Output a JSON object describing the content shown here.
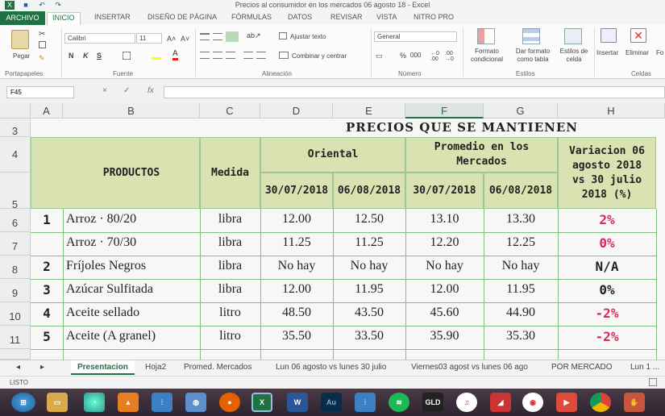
{
  "window": {
    "title": "Precios al consumidor en los mercados 06 agosto 18 - Excel"
  },
  "ribbon": {
    "tabs": [
      "ARCHIVO",
      "INICIO",
      "INSERTAR",
      "DISEÑO DE PÁGINA",
      "FÓRMULAS",
      "DATOS",
      "REVISAR",
      "VISTA",
      "NITRO PRO"
    ],
    "active_tab": "INICIO",
    "paste_label": "Pegar",
    "font_name": "Calibri",
    "font_size": "11",
    "bold": "N",
    "italic": "K",
    "underline": "S",
    "wrap_text": "Ajustar texto",
    "merge_center": "Combinar y centrar",
    "number_format": "General",
    "percent": "%",
    "thousands": "000",
    "conditional_format": "Formato condicional",
    "format_table": "Dar formato como tabla",
    "cell_styles": "Estilos de celda",
    "insert": "Insertar",
    "delete": "Eliminar",
    "format": "Fo",
    "groups": {
      "clipboard": "Portapapeles",
      "font": "Fuente",
      "alignment": "Alineación",
      "number": "Número",
      "styles": "Estilos",
      "cells": "Celdas"
    }
  },
  "formula_bar": {
    "name_box": "F45",
    "fx": "fx",
    "cancel": "×",
    "enter": "✓",
    "value": ""
  },
  "columns": [
    "A",
    "B",
    "C",
    "D",
    "E",
    "F",
    "G",
    "H"
  ],
  "selected_column": "F",
  "rows": [
    "3",
    "4",
    "5",
    "6",
    "7",
    "8",
    "9",
    "10",
    "11"
  ],
  "table": {
    "title": "PRECIOS QUE SE MANTIENEN",
    "header_productos": "PRODUCTOS",
    "header_medida": "Medida",
    "header_oriental": "Oriental",
    "header_promedio": "Promedio en los Mercados",
    "header_variacion": "Variacion 06 agosto 2018 vs 30 julio 2018 (%)",
    "date1": "30/07/2018",
    "date2": "06/08/2018",
    "date3": "30/07/2018",
    "date4": "06/08/2018",
    "items": [
      {
        "num": "1",
        "product": "Arroz · 80/20",
        "unit": "libra",
        "o1": "12.00",
        "o2": "12.50",
        "p1": "13.10",
        "p2": "13.30",
        "var": "2%",
        "var_color": "red"
      },
      {
        "num": "",
        "product": "Arroz · 70/30",
        "unit": "libra",
        "o1": "11.25",
        "o2": "11.25",
        "p1": "12.20",
        "p2": "12.25",
        "var": "0%",
        "var_color": "red"
      },
      {
        "num": "2",
        "product": "Fríjoles Negros",
        "unit": "libra",
        "o1": "No hay",
        "o2": "No hay",
        "p1": "No hay",
        "p2": "No hay",
        "var": "N/A",
        "var_color": "black"
      },
      {
        "num": "3",
        "product": "Azúcar Sulfitada",
        "unit": "libra",
        "o1": "12.00",
        "o2": "11.95",
        "p1": "12.00",
        "p2": "11.95",
        "var": "0%",
        "var_color": "black"
      },
      {
        "num": "4",
        "product": "Aceite sellado",
        "unit": "litro",
        "o1": "48.50",
        "o2": "43.50",
        "p1": "45.60",
        "p2": "44.90",
        "var": "-2%",
        "var_color": "red"
      },
      {
        "num": "5",
        "product": "Aceite (A granel)",
        "unit": "litro",
        "o1": "35.50",
        "o2": "33.50",
        "p1": "35.90",
        "p2": "35.30",
        "var": "-2%",
        "var_color": "red"
      }
    ]
  },
  "sheet_tabs": [
    "Presentacion",
    "Hoja2",
    "Promed. Mercados",
    "Lun 06 agosto vs lunes 30 julio",
    "Viernes03 agost vs lunes 06 ago",
    "POR MERCADO",
    "Lun 1 ..."
  ],
  "active_sheet": "Presentacion",
  "status": {
    "ready": "LISTO"
  },
  "taskbar": [
    "start",
    "explorer",
    "chrome-alt",
    "vlc",
    "mixer",
    "globe",
    "firefox",
    "excel",
    "word",
    "audition",
    "mixer2",
    "spotify",
    "gld-editor",
    "itunes",
    "media",
    "app-red",
    "app-video",
    "chrome",
    "app-misc"
  ],
  "colors": {
    "excel_green": "#1f7244",
    "header_fill": "#d9e2b0",
    "border_green": "#7fbf7f",
    "red": "#e0245e"
  }
}
